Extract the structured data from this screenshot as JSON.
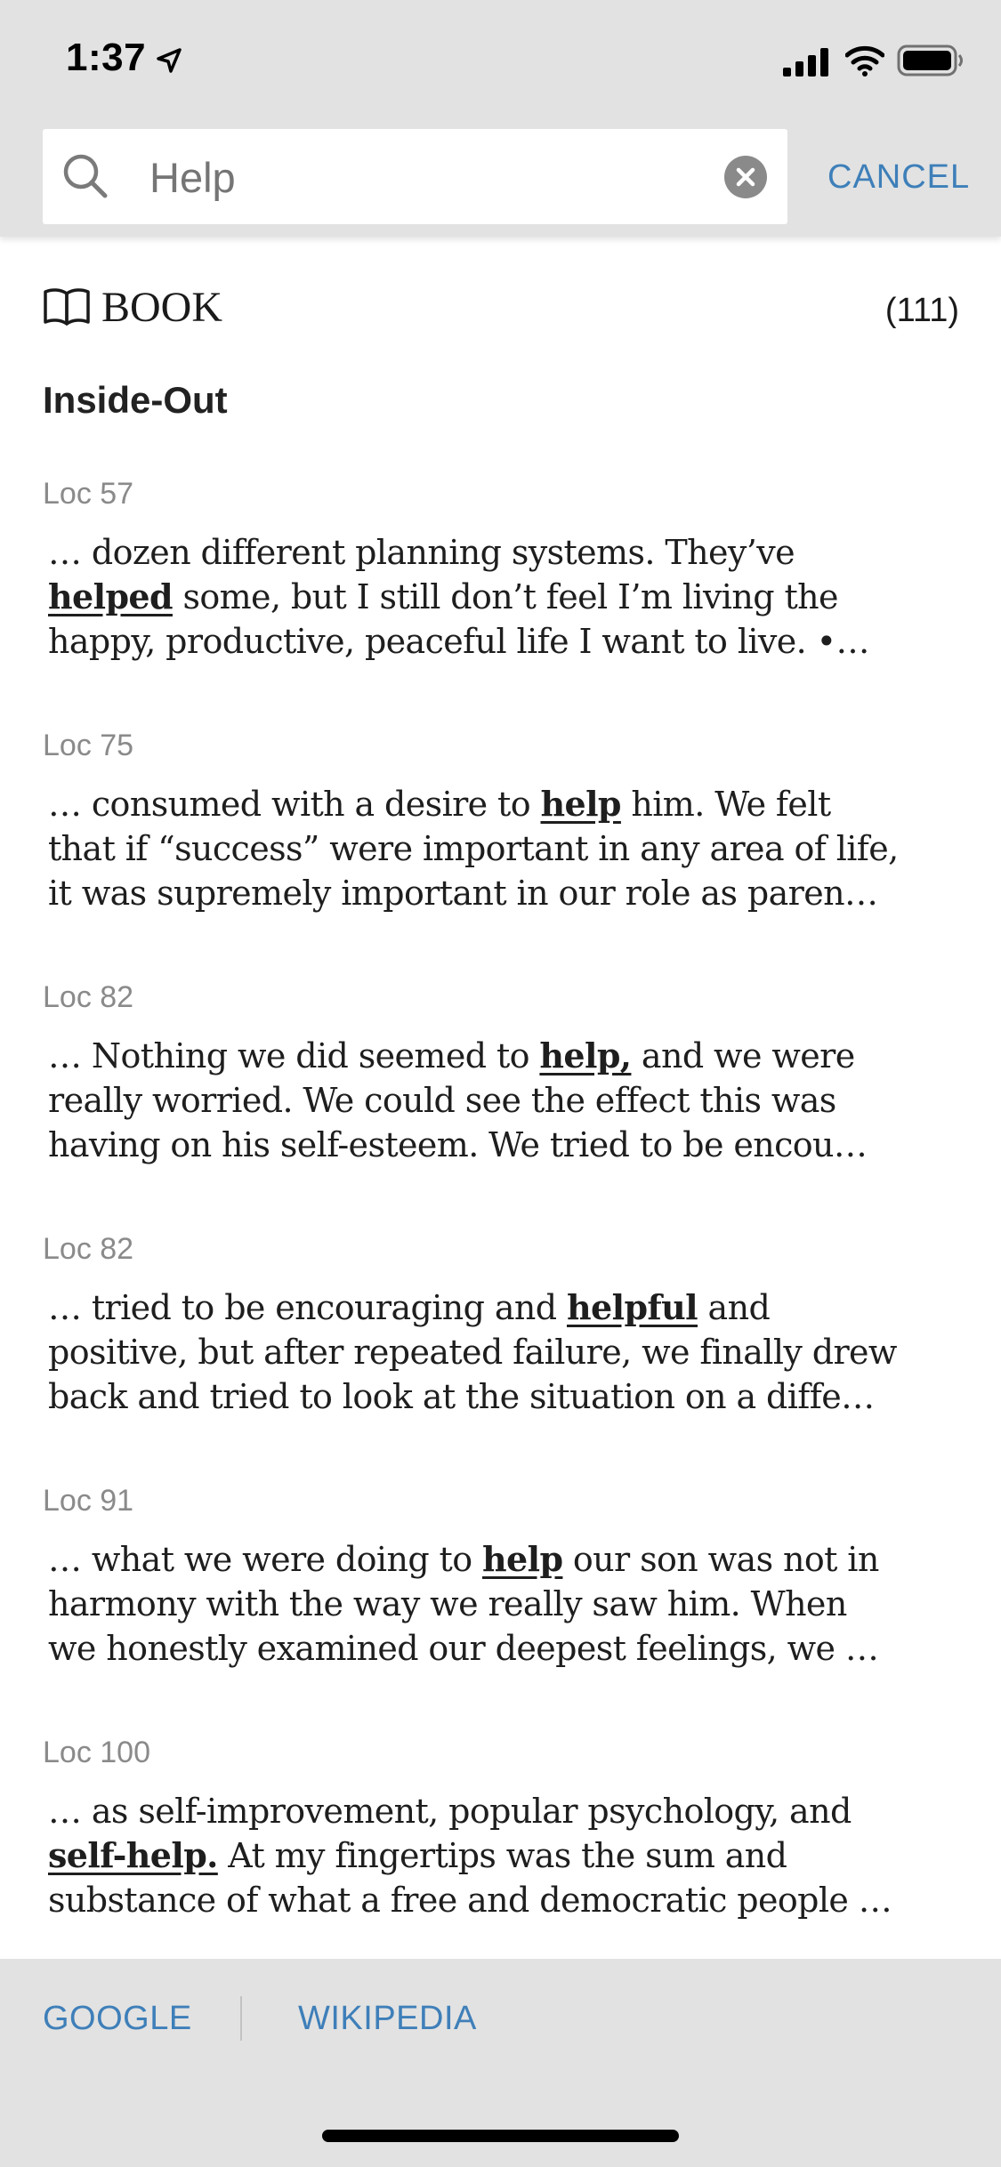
{
  "status_bar": {
    "time": "1:37"
  },
  "search": {
    "placeholder": "Help",
    "cancel_label": "CANCEL"
  },
  "section": {
    "label": "BOOK",
    "count": "(111)"
  },
  "chapter": {
    "title": "Inside-Out"
  },
  "results": [
    {
      "loc": "Loc 57",
      "lines": [
        [
          {
            "t": "… dozen different planning systems. They’ve"
          }
        ],
        [
          {
            "t": "helped",
            "h": true
          },
          {
            "t": " some, but I still don’t feel I’m living the"
          }
        ],
        [
          {
            "t": "happy, productive, peaceful life I want to live. •…"
          }
        ]
      ]
    },
    {
      "loc": "Loc 75",
      "lines": [
        [
          {
            "t": "… consumed with a desire to "
          },
          {
            "t": "help",
            "h": true
          },
          {
            "t": " him. We felt"
          }
        ],
        [
          {
            "t": "that if “success” were important in any area of life,"
          }
        ],
        [
          {
            "t": "it was supremely important in our role as paren…"
          }
        ]
      ]
    },
    {
      "loc": "Loc 82",
      "lines": [
        [
          {
            "t": "… Nothing we did seemed to "
          },
          {
            "t": "help,",
            "h": true
          },
          {
            "t": " and we were"
          }
        ],
        [
          {
            "t": "really worried. We could see the effect this was"
          }
        ],
        [
          {
            "t": "having on his self-esteem. We tried to be encou…"
          }
        ]
      ]
    },
    {
      "loc": "Loc 82",
      "lines": [
        [
          {
            "t": "… tried to be encouraging and "
          },
          {
            "t": "helpful",
            "h": true
          },
          {
            "t": " and"
          }
        ],
        [
          {
            "t": "positive, but after repeated failure, we finally drew"
          }
        ],
        [
          {
            "t": "back and tried to look at the situation on a diffe…"
          }
        ]
      ]
    },
    {
      "loc": "Loc 91",
      "lines": [
        [
          {
            "t": "… what we were doing to "
          },
          {
            "t": "help",
            "h": true
          },
          {
            "t": " our son was not in"
          }
        ],
        [
          {
            "t": "harmony with the way we really saw him. When"
          }
        ],
        [
          {
            "t": "we honestly examined our deepest feelings, we …"
          }
        ]
      ]
    },
    {
      "loc": "Loc 100",
      "lines": [
        [
          {
            "t": "… as self-improvement, popular psychology, and"
          }
        ],
        [
          {
            "t": "self-help.",
            "h": true
          },
          {
            "t": " At my fingertips was the sum and"
          }
        ],
        [
          {
            "t": "substance of what a free and democratic people …"
          }
        ]
      ]
    }
  ],
  "footer": {
    "google_label": "GOOGLE",
    "wikipedia_label": "WIKIPEDIA"
  },
  "icons": {
    "search": "search-icon",
    "clear": "clear-icon",
    "book": "book-icon",
    "location": "location-arrow-icon",
    "signal": "signal-icon",
    "wifi": "wifi-icon",
    "battery": "battery-icon"
  },
  "colors": {
    "accent": "#3e7fb9",
    "chrome_background": "#e2e2e2"
  }
}
